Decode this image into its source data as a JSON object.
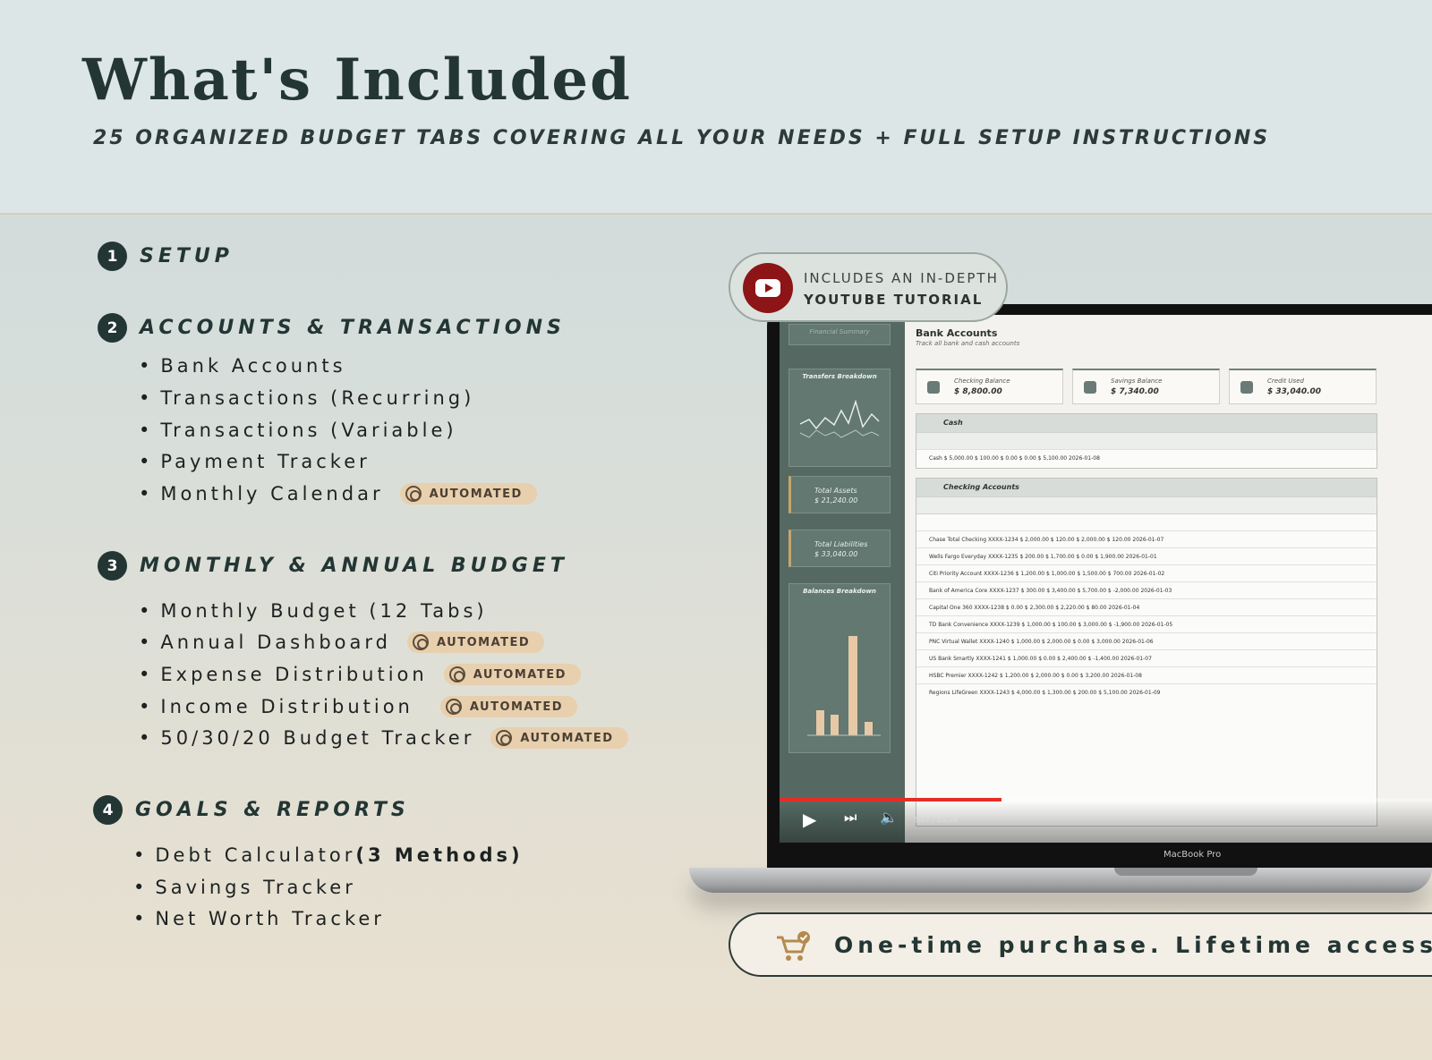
{
  "header": {
    "title": "What's Included",
    "subtitle": "25 ORGANIZED BUDGET TABS COVERING ALL YOUR NEEDS + FULL SETUP INSTRUCTIONS"
  },
  "badge_label": "AUTOMATED",
  "sections": [
    {
      "number": "1",
      "title": "SETUP",
      "items": []
    },
    {
      "number": "2",
      "title": "ACCOUNTS & TRANSACTIONS",
      "items": [
        "Bank Accounts",
        "Transactions (Recurring)",
        "Transactions (Variable)",
        "Payment Tracker",
        "Monthly Calendar"
      ]
    },
    {
      "number": "3",
      "title": "MONTHLY & ANNUAL BUDGET",
      "items": [
        "Monthly Budget (12 Tabs)",
        "Annual Dashboard",
        "Expense Distribution",
        "Income Distribution",
        "50/30/20 Budget Tracker"
      ]
    },
    {
      "number": "4",
      "title": "GOALS & REPORTS",
      "items": [
        "Debt Calculator ",
        "Savings Tracker",
        "Net Worth Tracker"
      ],
      "debt_bold": "(3 Methods)"
    }
  ],
  "youtube": {
    "line1": "INCLUDES AN IN-DEPTH",
    "line2": "YOUTUBE TUTORIAL"
  },
  "purchase": {
    "text": "One-time purchase. Lifetime access"
  },
  "laptop": {
    "brand": "MacBook Pro",
    "video_time": "5:07 / 15:28",
    "sidebar": {
      "tab": "Financial Summary",
      "chart1": "Transfers Breakdown",
      "total_assets_label": "Total Assets",
      "total_assets": "$ 21,240.00",
      "total_liabilities_label": "Total Liabilities",
      "total_liabilities": "$ 33,040.00",
      "chart2": "Balances Breakdown"
    },
    "sheet": {
      "title": "Bank Accounts",
      "subtitle": "Track all bank and cash accounts",
      "kpis": [
        {
          "label": "Checking Balance",
          "value": "$ 8,800.00"
        },
        {
          "label": "Savings Balance",
          "value": "$ 7,340.00"
        },
        {
          "label": "Credit Used",
          "value": "$ 33,040.00"
        }
      ],
      "cash_title": "Cash",
      "cash_row": "Cash      $ 5,000.00     $ 100.00     $ 0.00     $ 0.00     $ 5,100.00     2026-01-08",
      "checking_title": "Checking Accounts",
      "checking_rows": [
        "Chase Total Checking     XXXX-1234     $ 2,000.00     $ 120.00     $ 2,000.00     $ 120.00     2026-01-07",
        "Wells Fargo Everyday     XXXX-1235     $ 200.00     $ 1,700.00     $ 0.00     $ 1,900.00     2026-01-01",
        "Citi Priority Account     XXXX-1236     $ 1,200.00     $ 1,000.00     $ 1,500.00     $ 700.00     2026-01-02",
        "Bank of America Core     XXXX-1237     $ 300.00     $ 3,400.00     $ 5,700.00     $ -2,000.00     2026-01-03",
        "Capital One 360     XXXX-1238     $ 0.00     $ 2,300.00     $ 2,220.00     $ 80.00     2026-01-04",
        "TD Bank Convenience     XXXX-1239     $ 1,000.00     $ 100.00     $ 3,000.00     $ -1,900.00     2026-01-05",
        "PNC Virtual Wallet     XXXX-1240     $ 1,000.00     $ 2,000.00     $ 0.00     $ 3,000.00     2026-01-06",
        "US Bank Smartly     XXXX-1241     $ 1,000.00     $ 0.00     $ 2,400.00     $ -1,400.00     2026-01-07",
        "HSBC Premier     XXXX-1242     $ 1,200.00     $ 2,000.00     $ 0.00     $ 3,200.00     2026-01-08",
        "Regions LifeGreen     XXXX-1243     $ 4,000.00     $ 1,300.00     $ 200.00     $ 5,100.00     2026-01-09"
      ]
    }
  },
  "colors": {
    "dark": "#233634",
    "badge": "#e8cfae",
    "youtube": "#8d1417",
    "progress": "#e52d27"
  }
}
